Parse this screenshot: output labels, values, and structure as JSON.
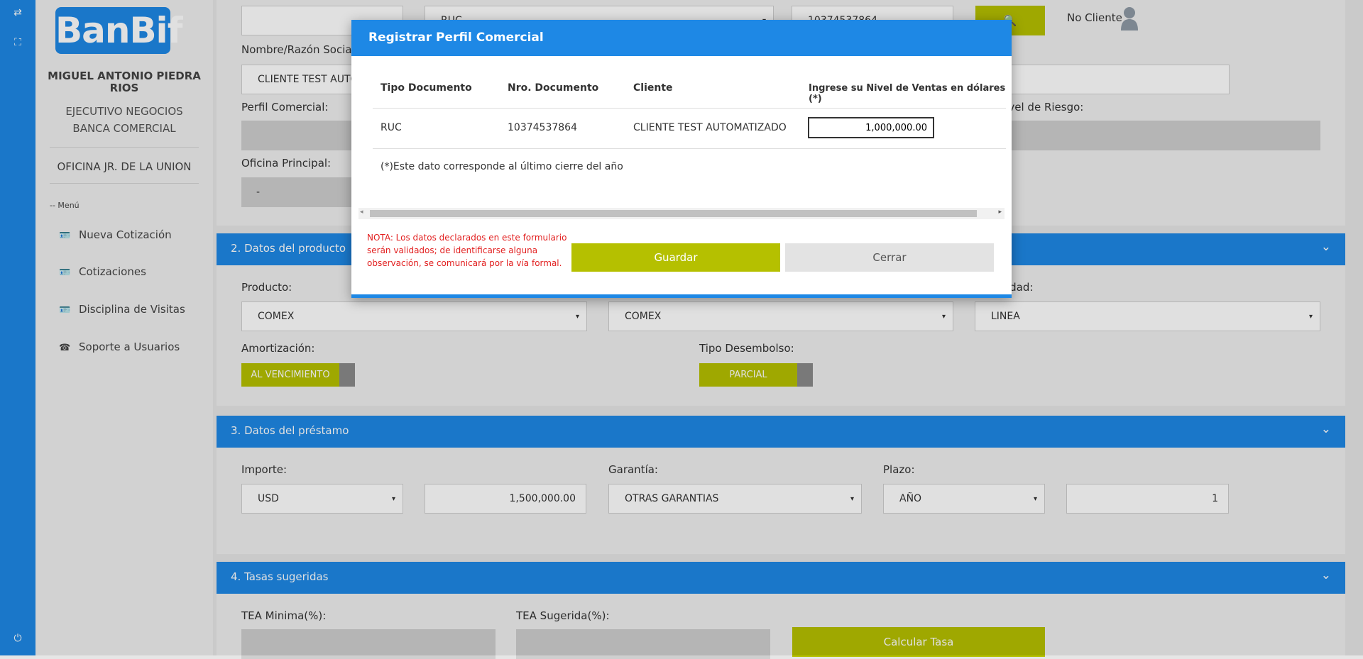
{
  "rail": {
    "icons": [
      "swap-icon",
      "expand-icon",
      "power-icon"
    ]
  },
  "sidebar": {
    "logo": "BanBif",
    "user_name": "MIGUEL ANTONIO PIEDRA RIOS",
    "role_line1": "EJECUTIVO NEGOCIOS",
    "role_line2": "BANCA COMERCIAL",
    "office": "OFICINA JR. DE LA UNION",
    "menu_header": "-- Menú",
    "menu": [
      {
        "label": "Nueva Cotización",
        "icon": "id-card-icon"
      },
      {
        "label": "Cotizaciones",
        "icon": "id-card-icon"
      },
      {
        "label": "Disciplina de Visitas",
        "icon": "id-card-icon"
      },
      {
        "label": "Soporte a Usuarios",
        "icon": "phone-icon"
      }
    ]
  },
  "client": {
    "doc_type": "RUC",
    "doc_number": "10374537864",
    "status": "No Cliente",
    "name_label": "Nombre/Razón Social :",
    "name_value": "CLIENTE TEST AUTOMATIZADO",
    "perfil_label": "Perfil Comercial:",
    "riesgo_label": "Nivel de Riesgo:",
    "oficina_label": "Oficina Principal:",
    "oficina_value": "-"
  },
  "section2": {
    "title": "2. Datos del producto",
    "producto_label": "Producto:",
    "producto_value": "COMEX",
    "subproducto_value": "COMEX",
    "modalidad_label": "Modalidad:",
    "modalidad_value": "LINEA",
    "amort_label": "Amortización:",
    "amort_value": "AL VENCIMIENTO",
    "desembolso_label": "Tipo Desembolso:",
    "desembolso_value": "PARCIAL"
  },
  "section3": {
    "title": "3. Datos del préstamo",
    "importe_label": "Importe:",
    "currency": "USD",
    "amount": "1,500,000.00",
    "garantia_label": "Garantía:",
    "garantia_value": "OTRAS GARANTIAS",
    "plazo_label": "Plazo:",
    "plazo_unit": "AÑO",
    "plazo_value": "1"
  },
  "section4": {
    "title": "4. Tasas sugeridas",
    "tea_min_label": "TEA Minima(%):",
    "tea_sug_label": "TEA Sugerida(%):",
    "calc_button": "Calcular Tasa"
  },
  "modal": {
    "title": "Registrar Perfil Comercial",
    "headers": [
      "Tipo Documento",
      "Nro. Documento",
      "Cliente",
      "Ingrese su Nivel de Ventas en dólares (*)"
    ],
    "row": {
      "tipo": "RUC",
      "nro": "10374537864",
      "cliente": "CLIENTE TEST AUTOMATIZADO",
      "ventas": "1,000,000.00"
    },
    "footnote": "(*)Este dato corresponde al último cierre del año",
    "note": "NOTA: Los datos declarados en este formulario serán validados; de identificarse alguna observación, se comunicará por la vía formal.",
    "save_button": "Guardar",
    "close_button": "Cerrar"
  },
  "colors": {
    "primary": "#1e88e5",
    "olive": "#b5c000",
    "note_red": "#e21f1f"
  }
}
